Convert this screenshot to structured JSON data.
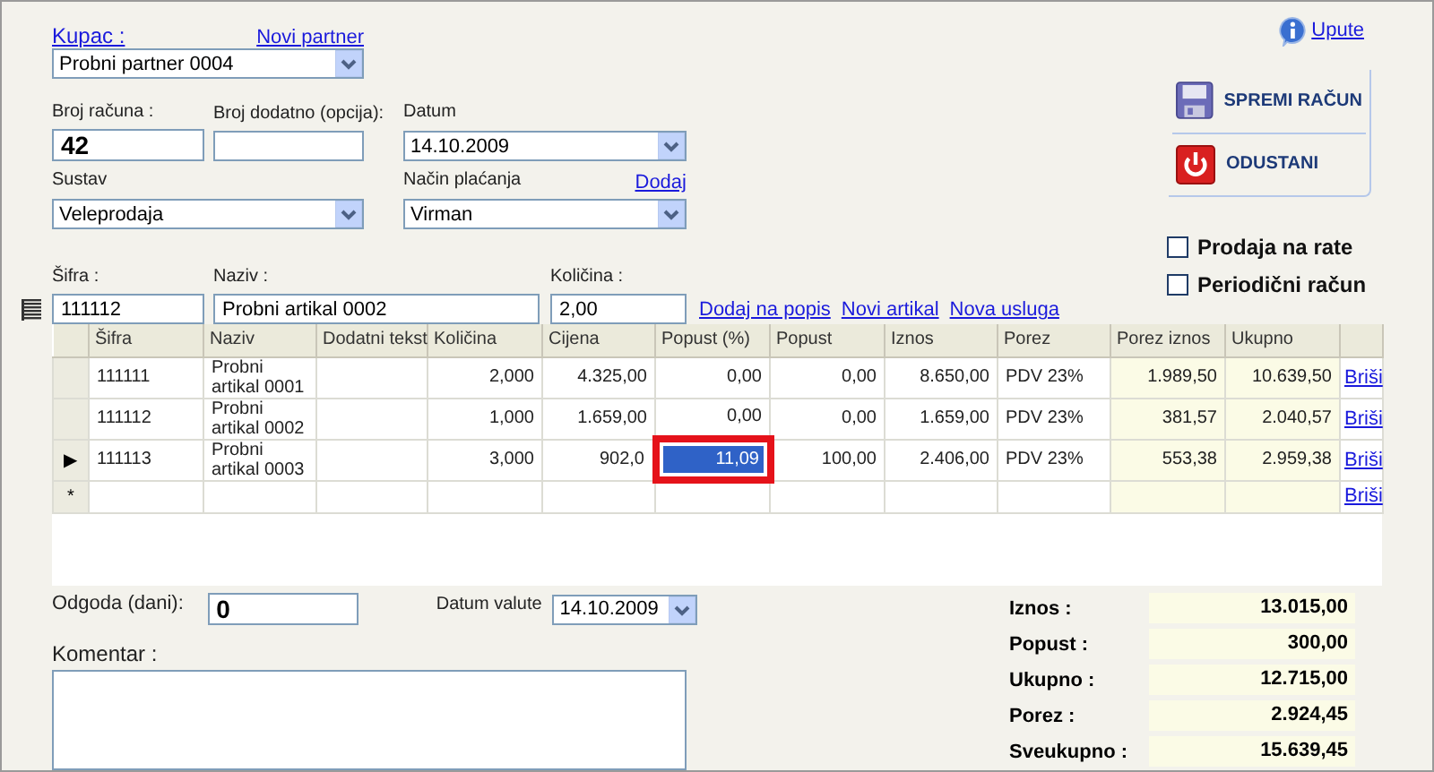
{
  "customer": {
    "label": "Kupac :",
    "link": "Novi partner",
    "value": "Probni partner 0004"
  },
  "invoice_number": {
    "label": "Broj računa :",
    "value": "42"
  },
  "extra_number": {
    "label": "Broj dodatno (opcija):"
  },
  "date": {
    "label": "Datum",
    "value": "14.10.2009"
  },
  "system": {
    "label": "Sustav",
    "value": "Veleprodaja"
  },
  "payment": {
    "label": "Način plaćanja",
    "link": "Dodaj",
    "value": "Virman"
  },
  "help_link": "Upute",
  "actions": [
    {
      "kind": "save",
      "label": "SPREMI RAČUN"
    },
    {
      "kind": "cancel",
      "label": "ODUSTANI"
    }
  ],
  "checkboxes": [
    {
      "label": "Prodaja na rate",
      "checked": false
    },
    {
      "label": "Periodični račun",
      "checked": false
    }
  ],
  "item_entry": {
    "code": {
      "label": "Šifra :",
      "value": "111112"
    },
    "name": {
      "label": "Naziv :",
      "value": "Probni artikal 0002"
    },
    "quantity": {
      "label": "Količina :",
      "value": "2,00"
    },
    "links": [
      "Dodaj na popis",
      "Novi artikal",
      "Nova usluga"
    ]
  },
  "table": {
    "columns": [
      "Šifra",
      "Naziv",
      "Dodatni tekst",
      "Količina",
      "Cijena",
      "Popust (%)",
      "Popust",
      "Iznos",
      "Porez",
      "Porez iznos",
      "Ukupno"
    ],
    "rows": [
      {
        "marker": "",
        "delete": "Briši",
        "cells": [
          {
            "text": "111111",
            "selected": false
          },
          {
            "text": "Probni artikal 0001",
            "selected": false
          },
          {
            "text": "",
            "selected": false
          },
          {
            "text": "2,000",
            "selected": false
          },
          {
            "text": "4.325,00",
            "selected": false
          },
          {
            "text": "0,00",
            "selected": false
          },
          {
            "text": "0,00",
            "selected": false
          },
          {
            "text": "8.650,00",
            "selected": false
          },
          {
            "text": "PDV 23%",
            "selected": false
          },
          {
            "text": "1.989,50",
            "selected": false
          },
          {
            "text": "10.639,50",
            "selected": false
          }
        ]
      },
      {
        "marker": "",
        "delete": "Briši",
        "cells": [
          {
            "text": "111112",
            "selected": false
          },
          {
            "text": "Probni artikal 0002",
            "selected": false
          },
          {
            "text": "",
            "selected": false
          },
          {
            "text": "1,000",
            "selected": false
          },
          {
            "text": "1.659,00",
            "selected": false
          },
          {
            "text": "0,00",
            "selected": false
          },
          {
            "text": "0,00",
            "selected": false
          },
          {
            "text": "1.659,00",
            "selected": false
          },
          {
            "text": "PDV 23%",
            "selected": false
          },
          {
            "text": "381,57",
            "selected": false
          },
          {
            "text": "2.040,57",
            "selected": false
          }
        ]
      },
      {
        "marker": "▶",
        "delete": "Briši",
        "cells": [
          {
            "text": "111113",
            "selected": false
          },
          {
            "text": "Probni artikal 0003",
            "selected": false
          },
          {
            "text": "",
            "selected": false
          },
          {
            "text": "3,000",
            "selected": false
          },
          {
            "text": "902,0",
            "selected": false
          },
          {
            "text": "11,09",
            "selected": true
          },
          {
            "text": "100,00",
            "selected": false
          },
          {
            "text": "2.406,00",
            "selected": false
          },
          {
            "text": "PDV 23%",
            "selected": false
          },
          {
            "text": "553,38",
            "selected": false
          },
          {
            "text": "2.959,38",
            "selected": false
          }
        ]
      },
      {
        "marker": "*",
        "delete": "Briši",
        "cells": [
          {
            "text": "",
            "selected": false
          },
          {
            "text": "",
            "selected": false
          },
          {
            "text": "",
            "selected": false
          },
          {
            "text": "",
            "selected": false
          },
          {
            "text": "",
            "selected": false
          },
          {
            "text": "",
            "selected": false
          },
          {
            "text": "",
            "selected": false
          },
          {
            "text": "",
            "selected": false
          },
          {
            "text": "",
            "selected": false
          },
          {
            "text": "",
            "selected": false
          },
          {
            "text": "",
            "selected": false
          }
        ]
      }
    ]
  },
  "delay": {
    "label": "Odgoda (dani):",
    "value": "0"
  },
  "value_date": {
    "label": "Datum valute",
    "value": "14.10.2009"
  },
  "comment": {
    "label": "Komentar :"
  },
  "totals": [
    {
      "label": "Iznos :",
      "value": "13.015,00"
    },
    {
      "label": "Popust :",
      "value": "300,00"
    },
    {
      "label": "Ukupno :",
      "value": "12.715,00"
    },
    {
      "label": "Porez :",
      "value": "2.924,45"
    },
    {
      "label": "Sveukupno :",
      "value": "15.639,45"
    }
  ]
}
